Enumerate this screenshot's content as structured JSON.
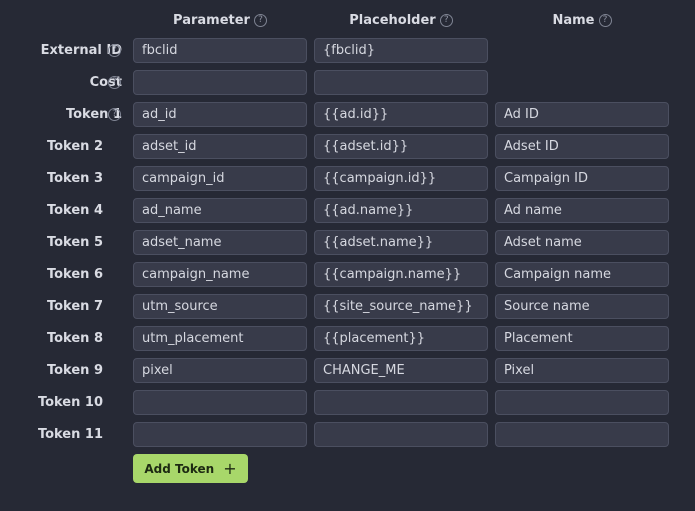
{
  "headers": {
    "parameter": "Parameter",
    "placeholder": "Placeholder",
    "name": "Name"
  },
  "rows": [
    {
      "label": "External ID",
      "help": true,
      "parameter": "fbclid",
      "placeholder": "{fbclid}",
      "name": null
    },
    {
      "label": "Cost",
      "help": true,
      "parameter": "",
      "placeholder": "",
      "name": null
    },
    {
      "label": "Token 1",
      "help": true,
      "parameter": "ad_id",
      "placeholder": "{{ad.id}}",
      "name": "Ad ID"
    },
    {
      "label": "Token 2",
      "help": false,
      "parameter": "adset_id",
      "placeholder": "{{adset.id}}",
      "name": "Adset ID"
    },
    {
      "label": "Token 3",
      "help": false,
      "parameter": "campaign_id",
      "placeholder": "{{campaign.id}}",
      "name": "Campaign ID"
    },
    {
      "label": "Token 4",
      "help": false,
      "parameter": "ad_name",
      "placeholder": "{{ad.name}}",
      "name": "Ad name"
    },
    {
      "label": "Token 5",
      "help": false,
      "parameter": "adset_name",
      "placeholder": "{{adset.name}}",
      "name": "Adset name"
    },
    {
      "label": "Token 6",
      "help": false,
      "parameter": "campaign_name",
      "placeholder": "{{campaign.name}}",
      "name": "Campaign name"
    },
    {
      "label": "Token 7",
      "help": false,
      "parameter": "utm_source",
      "placeholder": "{{site_source_name}}",
      "name": "Source name"
    },
    {
      "label": "Token 8",
      "help": false,
      "parameter": "utm_placement",
      "placeholder": "{{placement}}",
      "name": "Placement"
    },
    {
      "label": "Token 9",
      "help": false,
      "parameter": "pixel",
      "placeholder": "CHANGE_ME",
      "name": "Pixel"
    },
    {
      "label": "Token 10",
      "help": false,
      "parameter": "",
      "placeholder": "",
      "name": ""
    },
    {
      "label": "Token 11",
      "help": false,
      "parameter": "",
      "placeholder": "",
      "name": ""
    }
  ],
  "add_token": {
    "label": "Add Token",
    "icon": "plus-icon"
  },
  "colors": {
    "background": "#262935",
    "field": "#383b4a",
    "field_border": "#4b4f60",
    "accent": "#a8d76a"
  }
}
